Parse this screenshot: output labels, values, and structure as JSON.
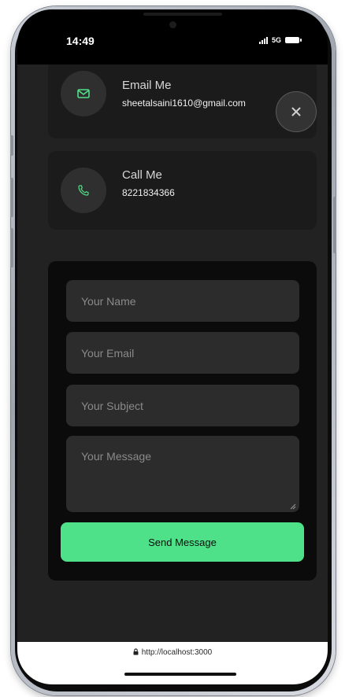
{
  "status_bar": {
    "time": "14:49",
    "network": "5G"
  },
  "contact": {
    "email": {
      "title": "Email Me",
      "value": "sheetalsaini1610@gmail.com",
      "icon": "mail-icon"
    },
    "phone": {
      "title": "Call Me",
      "value": "8221834366",
      "icon": "phone-icon"
    },
    "close_icon": "close-icon"
  },
  "form": {
    "name_placeholder": "Your Name",
    "email_placeholder": "Your Email",
    "subject_placeholder": "Your Subject",
    "message_placeholder": "Your Message",
    "submit_label": "Send Message"
  },
  "browser": {
    "url": "http://localhost:3000"
  },
  "colors": {
    "accent": "#4fe08a",
    "background": "#222222",
    "card": "#1b1b1b",
    "field": "#2c2c2c"
  }
}
